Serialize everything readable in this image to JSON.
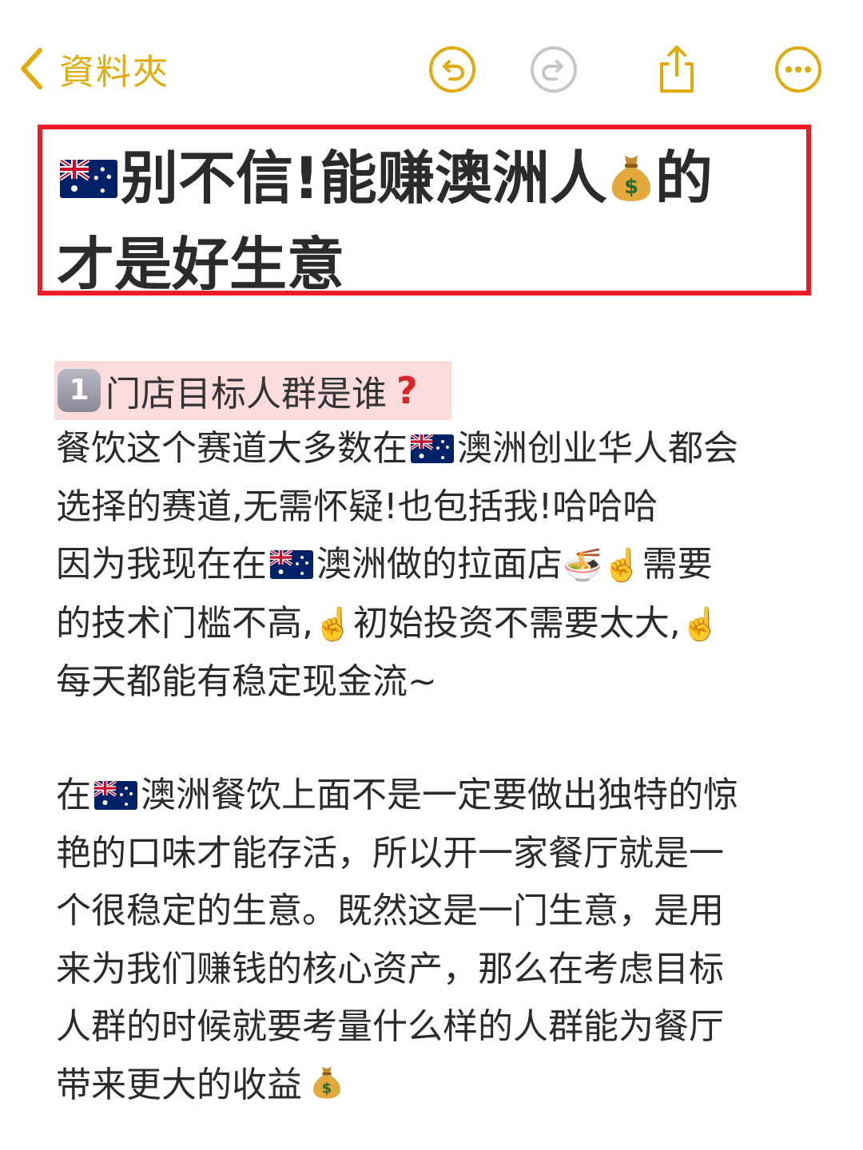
{
  "toolbar": {
    "back_label": "資料夾",
    "accent_color": "#e3aa0c",
    "icons": [
      "chevron-left-icon",
      "undo-icon",
      "redo-icon",
      "share-icon",
      "more-icon"
    ]
  },
  "title": {
    "line1_text": "别不信!能赚澳洲人",
    "line1_tail": "的",
    "line2": "才是好生意",
    "border_color": "#ee1c25"
  },
  "section1": {
    "number": "1",
    "heading": "门店目标人群是谁",
    "qmark": "?"
  },
  "para1": {
    "l1a": "餐饮这个赛道大多数在",
    "l1b": "澳洲创业华人都会",
    "l2": "选择的赛道,无需怀疑!也包括我!哈哈哈",
    "l3a": "因为我现在在",
    "l3b": "澳洲做的拉面店",
    "l3c": "需要",
    "l4a": "的技术门槛不高,",
    "l4b": "初始投资不需要太大,",
    "l5": "每天都能有稳定现金流~"
  },
  "para2": {
    "l1a": "在",
    "l1b": "澳洲餐饮上面不是一定要做出独特的惊",
    "l2": "艳的口味才能存活，所以开一家餐厅就是一",
    "l3": "个很稳定的生意。既然这是一门生意，是用",
    "l4": "来为我们赚钱的核心资产，那么在考虑目标",
    "l5": "人群的时候就要考量什么样的人群能为餐厅",
    "l6": "带来更大的收益"
  },
  "emojis": {
    "flag": "australia-flag",
    "money": "money-bag",
    "noodles": "🍜",
    "point_up": "☝️"
  }
}
